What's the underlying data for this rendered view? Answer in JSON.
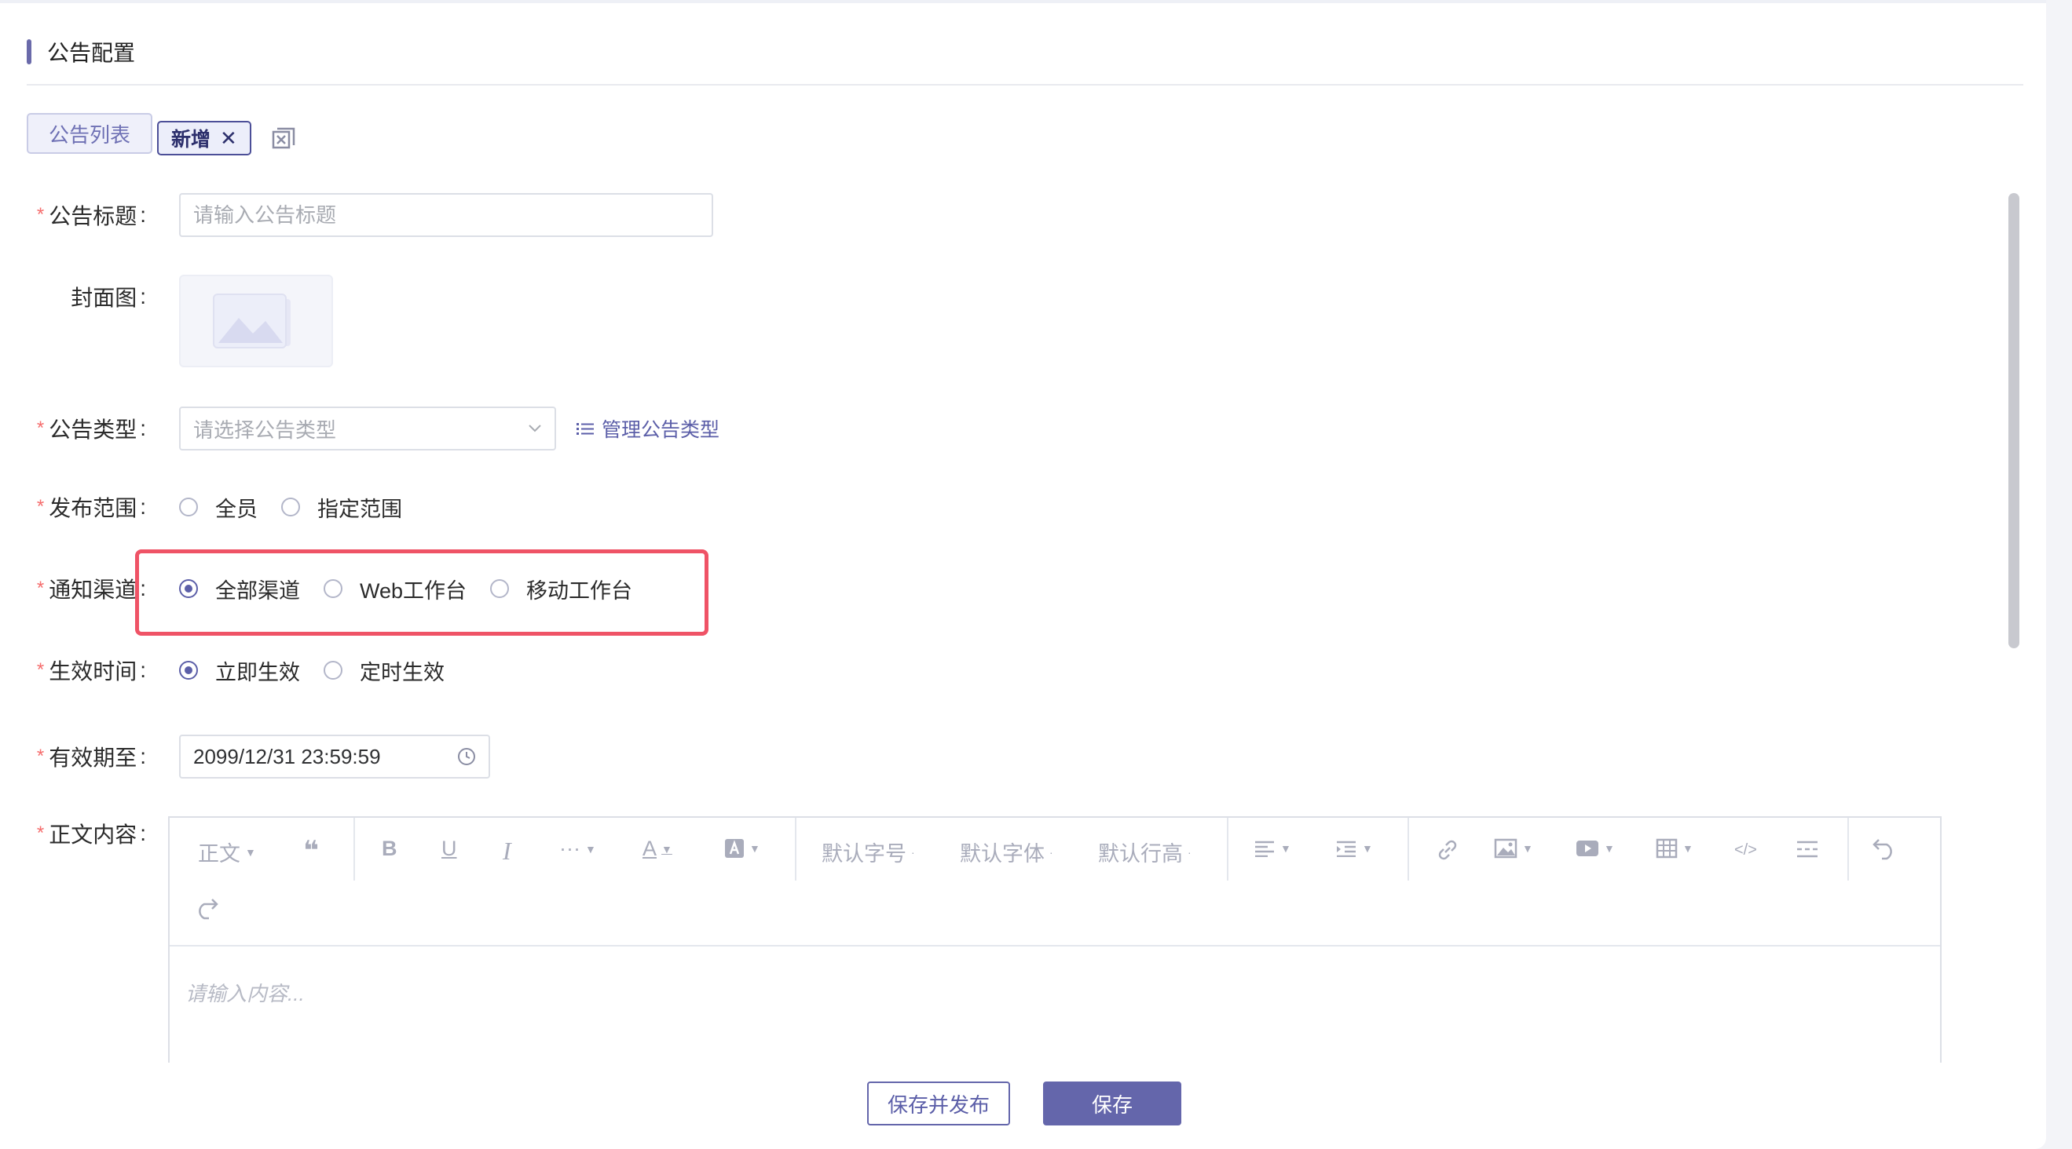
{
  "page": {
    "title": "公告配置"
  },
  "tabs": {
    "list_label": "公告列表",
    "new_label": "新增",
    "new_close": "✕"
  },
  "form": {
    "title_field": {
      "label": "公告标题",
      "placeholder": "请输入公告标题",
      "value": ""
    },
    "cover_field": {
      "label": "封面图"
    },
    "type_field": {
      "label": "公告类型",
      "placeholder": "请选择公告类型",
      "manage_link": "管理公告类型"
    },
    "scope_field": {
      "label": "发布范围",
      "options": [
        "全员",
        "指定范围"
      ],
      "selected": null
    },
    "channel_field": {
      "label": "通知渠道",
      "options": [
        "全部渠道",
        "Web工作台",
        "移动工作台"
      ],
      "selected": "全部渠道"
    },
    "effective_field": {
      "label": "生效时间",
      "options": [
        "立即生效",
        "定时生效"
      ],
      "selected": "立即生效"
    },
    "expiry_field": {
      "label": "有效期至",
      "value": "2099/12/31 23:59:59"
    },
    "content_field": {
      "label": "正文内容",
      "placeholder": "请输入内容..."
    }
  },
  "editor_toolbar": {
    "paragraph": "正文",
    "font_size": "默认字号",
    "font_family": "默认字体",
    "line_height": "默认行高",
    "bold": "B",
    "underline": "U",
    "italic": "I",
    "more": "···",
    "font_color": "A"
  },
  "actions": {
    "save_publish": "保存并发布",
    "save": "保存"
  },
  "colors": {
    "accent": "#6466ab",
    "required": "#f56c6c",
    "highlight": "#ef5366"
  }
}
